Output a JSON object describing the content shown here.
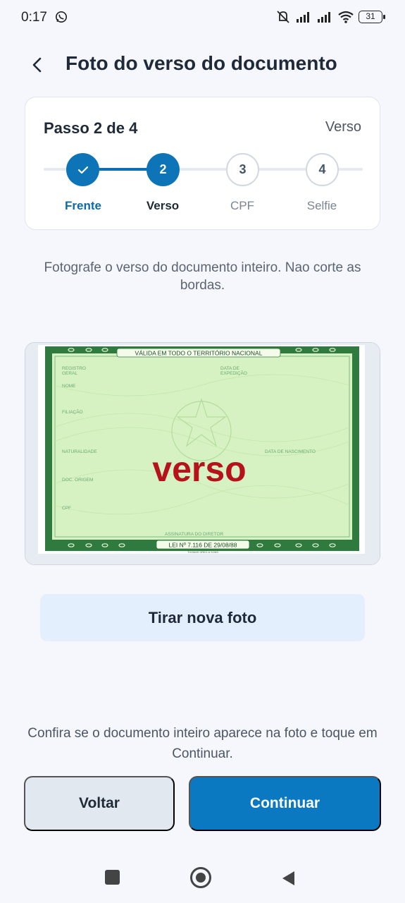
{
  "status_bar": {
    "time": "0:17",
    "battery": "31"
  },
  "header": {
    "title": "Foto do verso do documento"
  },
  "stepper": {
    "title": "Passo 2 de 4",
    "current_label": "Verso",
    "steps": [
      {
        "number": "",
        "label": "Frente",
        "state": "done"
      },
      {
        "number": "2",
        "label": "Verso",
        "state": "active"
      },
      {
        "number": "3",
        "label": "CPF",
        "state": "pending"
      },
      {
        "number": "4",
        "label": "Selfie",
        "state": "pending"
      }
    ]
  },
  "instruction": "Fotografe o verso do documento inteiro. Nao corte as bordas.",
  "document": {
    "top_banner": "VÁLIDA EM TODO O TERRITÓRIO NACIONAL",
    "field_registro_1": "REGISTRO",
    "field_registro_2": "GERAL",
    "field_expedicao_1": "DATA DE",
    "field_expedicao_2": "EXPEDIÇÃO",
    "field_nome": "NOME",
    "field_filiacao": "FILIAÇÃO",
    "field_naturalidade": "NATURALIDADE",
    "field_nascimento": "DATA DE NASCIMENTO",
    "field_origem": "DOC. ORIGEM",
    "field_cpf": "CPF",
    "signature": "ASSINATURA DO DIRETOR",
    "law": "LEI Nº 7.116 DE 29/08/88",
    "printer": "THOMAS GREG & SONS",
    "watermark": "verso"
  },
  "retake_button": "Tirar nova foto",
  "confirm_text": "Confira se o documento inteiro aparece na foto e toque em Continuar.",
  "buttons": {
    "back": "Voltar",
    "continue": "Continuar"
  },
  "colors": {
    "primary": "#0b79c1",
    "doc_green": "#2f7a3f",
    "doc_bg": "#d7f2c2",
    "watermark": "#b5121b"
  }
}
